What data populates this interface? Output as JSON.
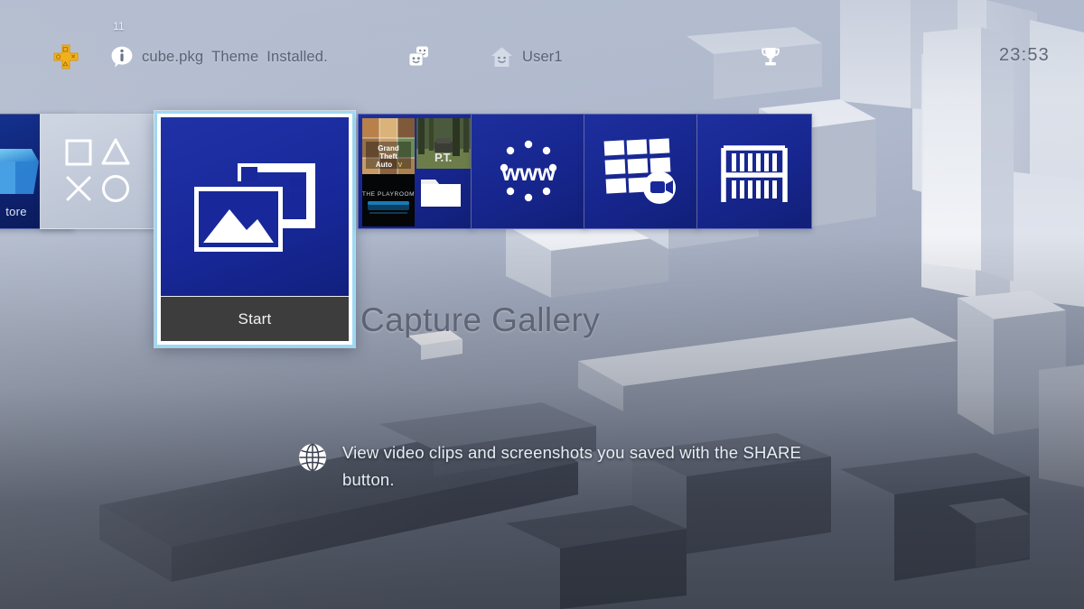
{
  "system": {
    "platform": "PlayStation 4 Home Screen",
    "clock": "23:53",
    "user": "User1"
  },
  "topbar": {
    "ps_plus_icon": "playstation-plus-icon",
    "notification": {
      "badge_count": "11",
      "icon": "info-bubble-icon",
      "file_name": "cube.pkg",
      "item_type": "Theme",
      "status": "Installed."
    },
    "friends_icon": "friends-faces-icon",
    "home_icon": "home-user-icon",
    "user_label": "User1",
    "trophy_icon": "trophy-icon",
    "clock_label": "23:53"
  },
  "tiles": [
    {
      "id": "ps-store",
      "name": "PlayStation Store",
      "label": "tore",
      "icon": "store-bag-icon",
      "selected": false,
      "partial": true
    },
    {
      "id": "whats-new",
      "name": "What's New",
      "icon": "playstation-shapes-icon",
      "selected": false
    },
    {
      "id": "capture-gallery",
      "name": "Capture Gallery",
      "icon": "capture-gallery-icon",
      "action_label": "Start",
      "selected": true
    },
    {
      "id": "library-recent",
      "name": "Recently Played",
      "icon": "game-thumbnails-icon",
      "thumbnails": [
        "Grand Theft Auto V",
        "P.T.",
        "The Playroom",
        "folder-icon"
      ],
      "selected": false
    },
    {
      "id": "internet-browser",
      "name": "Internet Browser",
      "icon": "www-browser-icon",
      "label": "www",
      "selected": false
    },
    {
      "id": "live-from-playstation",
      "name": "Live from PlayStation",
      "icon": "live-broadcast-grid-icon",
      "selected": false
    },
    {
      "id": "library",
      "name": "Library",
      "icon": "bookshelf-icon",
      "selected": false
    }
  ],
  "selection": {
    "title": "Capture Gallery",
    "start_label": "Start",
    "description": "View video clips and screenshots you saved with the SHARE button.",
    "description_icon": "globe-icon"
  },
  "colors": {
    "tile_blue": "#18289a",
    "tile_blue_light": "#1f32a6",
    "selection_border": "#9fd8f2",
    "start_bar": "#3d3d3d",
    "ps_plus_gold": "#f0b429",
    "background_top": "#b2bace",
    "background_bottom": "#2e333f",
    "title_text": "#5f6575",
    "topbar_text": "#5b6273"
  }
}
